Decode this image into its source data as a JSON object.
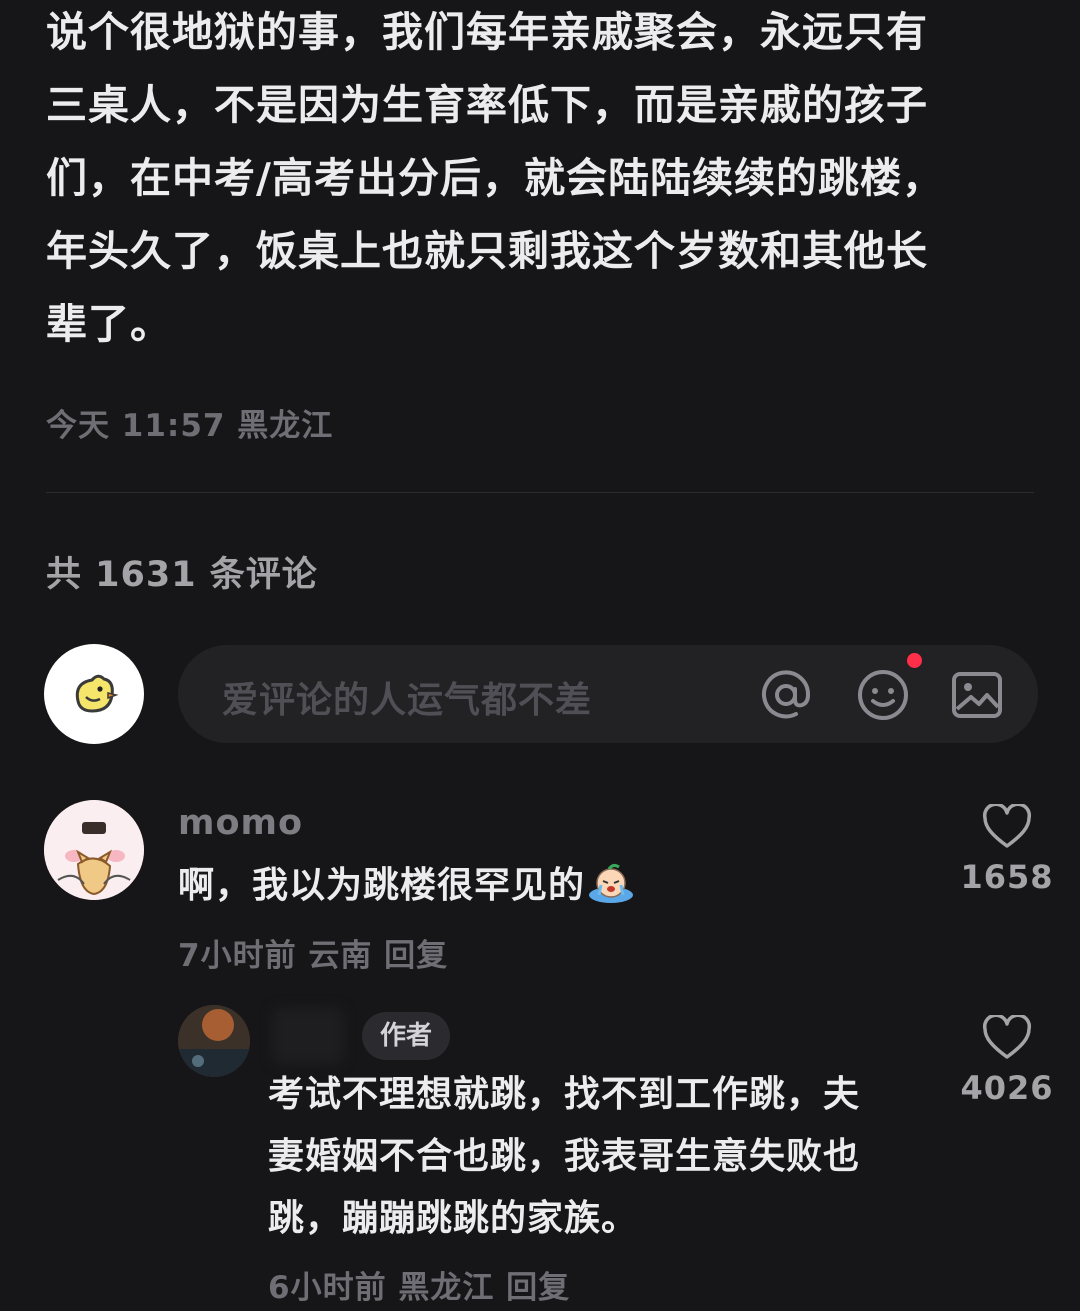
{
  "post": {
    "body": "说个很地狱的事，我们每年亲戚聚会，永远只有\n三桌人，不是因为生育率低下，而是亲戚的孩子\n们，在中考/高考出分后，就会陆陆续续的跳楼，\n年头久了，饭桌上也就只剩我这个岁数和其他长\n辈了。",
    "meta": "今天 11:57 黑龙江"
  },
  "comments_section": {
    "count_text": "共 1631 条评论",
    "input_placeholder": "爱评论的人运气都不差",
    "icons": [
      "avatar-chick-icon",
      "at-icon",
      "emoji-icon",
      "image-icon"
    ]
  },
  "comments": [
    {
      "name": "momo",
      "text": "啊，我以为跳楼很罕见的",
      "emoji": "crying-emoji-icon",
      "meta": "7小时前 云南 回复",
      "likes": "1658"
    }
  ],
  "replies": [
    {
      "badge": "作者",
      "text": "考试不理想就跳，找不到工作跳，夫\n妻婚姻不合也跳，我表哥生意失败也\n跳，蹦蹦跳跳的家族。",
      "meta": "6小时前 黑龙江 回复",
      "likes": "4026"
    }
  ],
  "colors": {
    "background": "#161618",
    "text": "#ececef",
    "muted": "#6e6e74",
    "input_bg": "#222225",
    "notify_dot": "#ff2f49"
  }
}
